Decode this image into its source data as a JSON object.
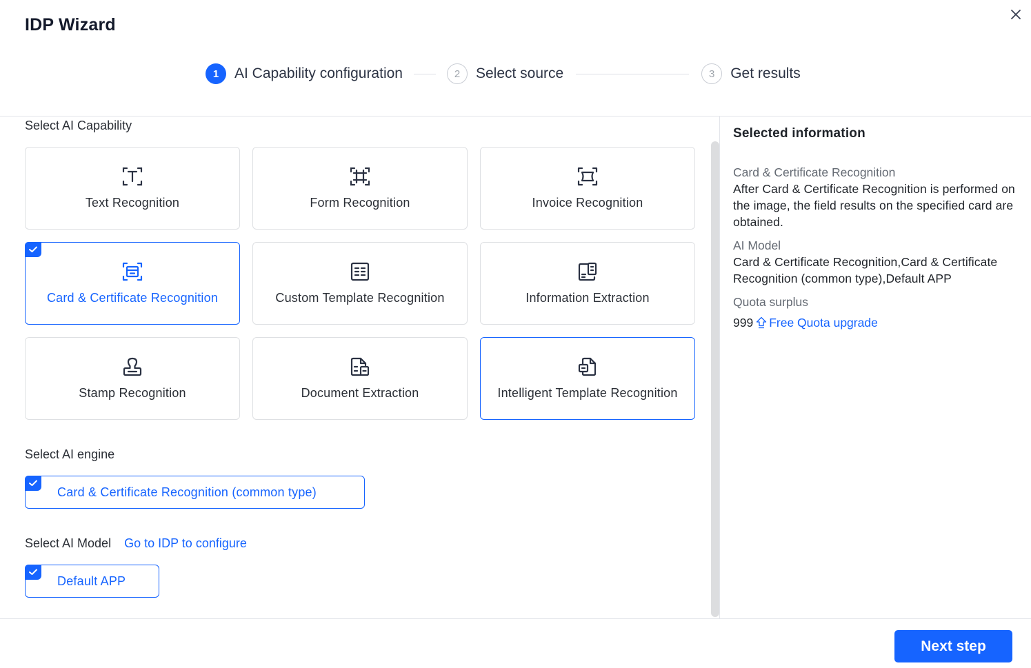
{
  "dialog": {
    "title": "IDP Wizard",
    "close_icon": "close-icon"
  },
  "steps": [
    {
      "number": "1",
      "label": "AI Capability configuration",
      "state": "active"
    },
    {
      "number": "2",
      "label": "Select source",
      "state": "inactive"
    },
    {
      "number": "3",
      "label": "Get results",
      "state": "inactive"
    }
  ],
  "capability": {
    "section_label": "Select AI Capability",
    "items": [
      {
        "label": "Text Recognition",
        "icon": "text-scan-icon",
        "selected": false
      },
      {
        "label": "Form Recognition",
        "icon": "form-scan-icon",
        "selected": false
      },
      {
        "label": "Invoice Recognition",
        "icon": "invoice-scan-icon",
        "selected": false
      },
      {
        "label": "Card & Certificate Recognition",
        "icon": "card-scan-icon",
        "selected": true
      },
      {
        "label": "Custom Template Recognition",
        "icon": "custom-template-icon",
        "selected": false
      },
      {
        "label": "Information Extraction",
        "icon": "information-extraction-icon",
        "selected": false
      },
      {
        "label": "Stamp Recognition",
        "icon": "stamp-icon",
        "selected": false
      },
      {
        "label": "Document Extraction",
        "icon": "document-extraction-icon",
        "selected": false
      },
      {
        "label": "Intelligent Template Recognition",
        "icon": "intelligent-template-icon",
        "selected": false
      }
    ]
  },
  "engine": {
    "section_label": "Select AI engine",
    "selected_option": "Card & Certificate Recognition (common type)"
  },
  "model": {
    "section_label": "Select AI Model",
    "configure_link": "Go to IDP to configure",
    "selected_option": "Default APP"
  },
  "info": {
    "title": "Selected information",
    "capability_key": "Card & Certificate Recognition",
    "capability_desc": "After Card & Certificate Recognition is performed on the image, the field results on the specified card are obtained.",
    "model_key": "AI Model",
    "model_value": "Card & Certificate Recognition,Card & Certificate Recognition (common type),Default APP",
    "quota_key": "Quota surplus",
    "quota_value": "999",
    "upgrade_link": "Free Quota upgrade"
  },
  "footer": {
    "next_label": "Next step"
  },
  "colors": {
    "accent": "#1664ff",
    "text": "#1f2329",
    "muted": "#646a73",
    "border": "#dee0e3"
  }
}
